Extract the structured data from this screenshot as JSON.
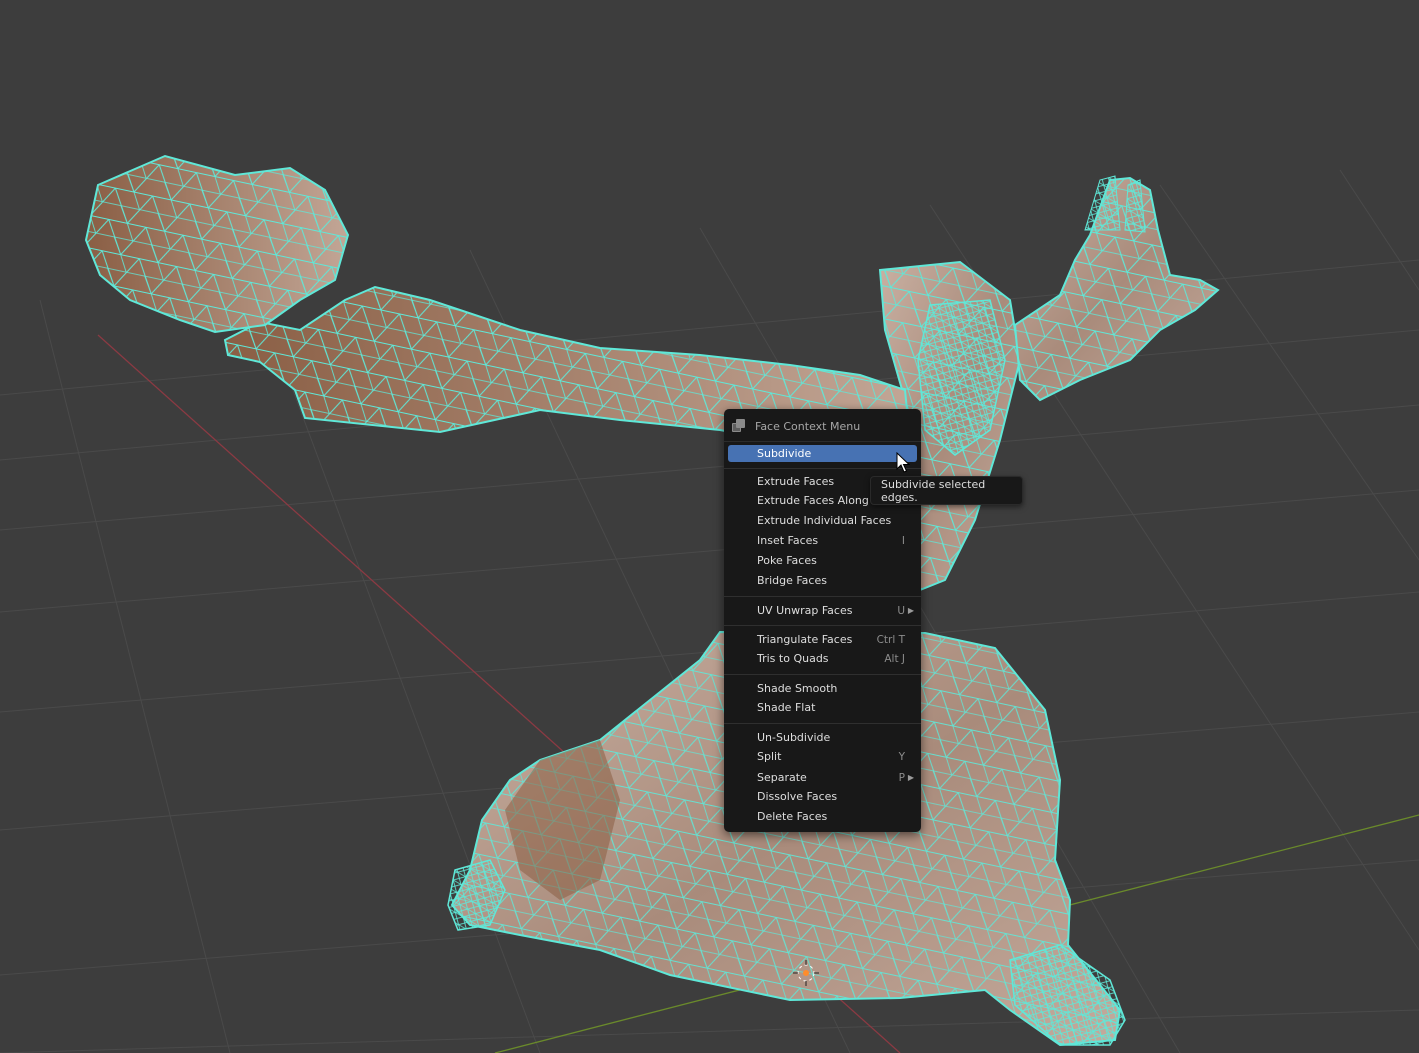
{
  "menu": {
    "title": "Face Context Menu",
    "title_icon": "face-select-mode-icon",
    "items": [
      {
        "label": "Subdivide",
        "shortcut": "",
        "active": true
      },
      {
        "label": "Extrude Faces",
        "shortcut": ""
      },
      {
        "label": "Extrude Faces Along N",
        "shortcut": ""
      },
      {
        "label": "Extrude Individual Faces",
        "shortcut": ""
      },
      {
        "label": "Inset Faces",
        "shortcut": "I"
      },
      {
        "label": "Poke Faces",
        "shortcut": ""
      },
      {
        "label": "Bridge Faces",
        "shortcut": ""
      },
      {
        "label": "UV Unwrap Faces",
        "shortcut": "U",
        "submenu": true
      },
      {
        "label": "Triangulate Faces",
        "shortcut": "Ctrl T"
      },
      {
        "label": "Tris to Quads",
        "shortcut": "Alt J"
      },
      {
        "label": "Shade Smooth",
        "shortcut": ""
      },
      {
        "label": "Shade Flat",
        "shortcut": ""
      },
      {
        "label": "Un-Subdivide",
        "shortcut": ""
      },
      {
        "label": "Split",
        "shortcut": "Y"
      },
      {
        "label": "Separate",
        "shortcut": "P",
        "submenu": true
      },
      {
        "label": "Dissolve Faces",
        "shortcut": ""
      },
      {
        "label": "Delete Faces",
        "shortcut": ""
      }
    ]
  },
  "tooltip": {
    "text": "Subdivide selected edges."
  },
  "colors": {
    "viewport_bg": "#3d3d3d",
    "grid": "#494949",
    "x_axis": "#8b3a43",
    "y_axis": "#6a8a2b",
    "mesh_fill": "#b89e90",
    "wire": "#5fe8d8",
    "menu_bg": "#181818",
    "highlight": "#4772b3"
  }
}
